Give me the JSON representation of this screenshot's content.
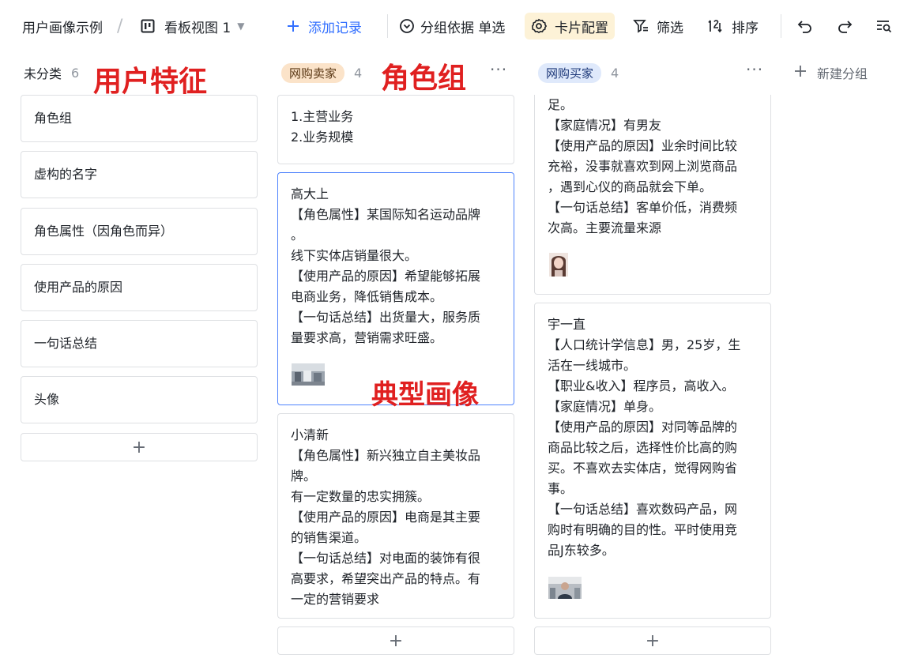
{
  "toolbar": {
    "breadcrumb_root": "用户画像示例",
    "breadcrumb_sep": "/",
    "view_name": "看板视图 1",
    "add_record": "添加记录",
    "group_by": "分组依据 单选",
    "card_config": "卡片配置",
    "filter": "筛选",
    "sort": "排序"
  },
  "columns": [
    {
      "name": "未分类",
      "count": "6",
      "fields": [
        "角色组",
        "虚构的名字",
        "角色属性（因角色而异）",
        "使用产品的原因",
        "一句话总结",
        "头像"
      ]
    },
    {
      "name": "网购卖家",
      "count": "4",
      "cards": [
        {
          "lines": [
            "1.主营业务",
            "2.业务规模"
          ]
        },
        {
          "lines": [
            "高大上",
            "【角色属性】某国际知名运动品牌",
            "。",
            "线下实体店销量很大。",
            "【使用产品的原因】希望能够拓展",
            "电商业务，降低销售成本。",
            "【一句话总结】出货量大，服务质",
            "量要求高，营销需求旺盛。"
          ]
        },
        {
          "lines": [
            "小清新",
            "【角色属性】新兴独立自主美妆品",
            "牌。",
            "有一定数量的忠实拥簇。",
            "【使用产品的原因】电商是其主要",
            "的销售渠道。",
            "【一句话总结】对电面的装饰有很",
            "高要求，希望突出产品的特点。有",
            "一定的营销要求"
          ]
        }
      ]
    },
    {
      "name": "网购买家",
      "count": "4",
      "cards": [
        {
          "lines": [
            "足。",
            "【家庭情况】有男友",
            "【使用产品的原因】业余时间比较",
            "充裕，没事就喜欢到网上浏览商品",
            "，遇到心仪的商品就会下单。",
            "【一句话总结】客单价低，消费频",
            "次高。主要流量来源"
          ]
        },
        {
          "lines": [
            "宇一直",
            "【人口统计学信息】男，25岁，生",
            "活在一线城市。",
            "【职业&收入】程序员，高收入。",
            "【家庭情况】单身。",
            "【使用产品的原因】对同等品牌的",
            "商品比较之后，选择性价比高的购",
            "买。不喜欢去实体店，觉得网购省",
            "事。",
            "【一句话总结】喜欢数码产品，网",
            "购时有明确的目的性。平时使用竞",
            "品J东较多。"
          ]
        }
      ]
    }
  ],
  "new_group": "新建分组",
  "add_symbol": "+",
  "more_symbol": "···",
  "annotations": {
    "user_features": "用户特征",
    "role_group": "角色组",
    "typical_persona": "典型画像"
  },
  "colors": {
    "accent": "#3370ff",
    "annotation": "#e02020",
    "seller_pill": "#fbe3c9",
    "buyer_pill": "#dfe9fb",
    "active_tool": "#fdf2d7"
  }
}
